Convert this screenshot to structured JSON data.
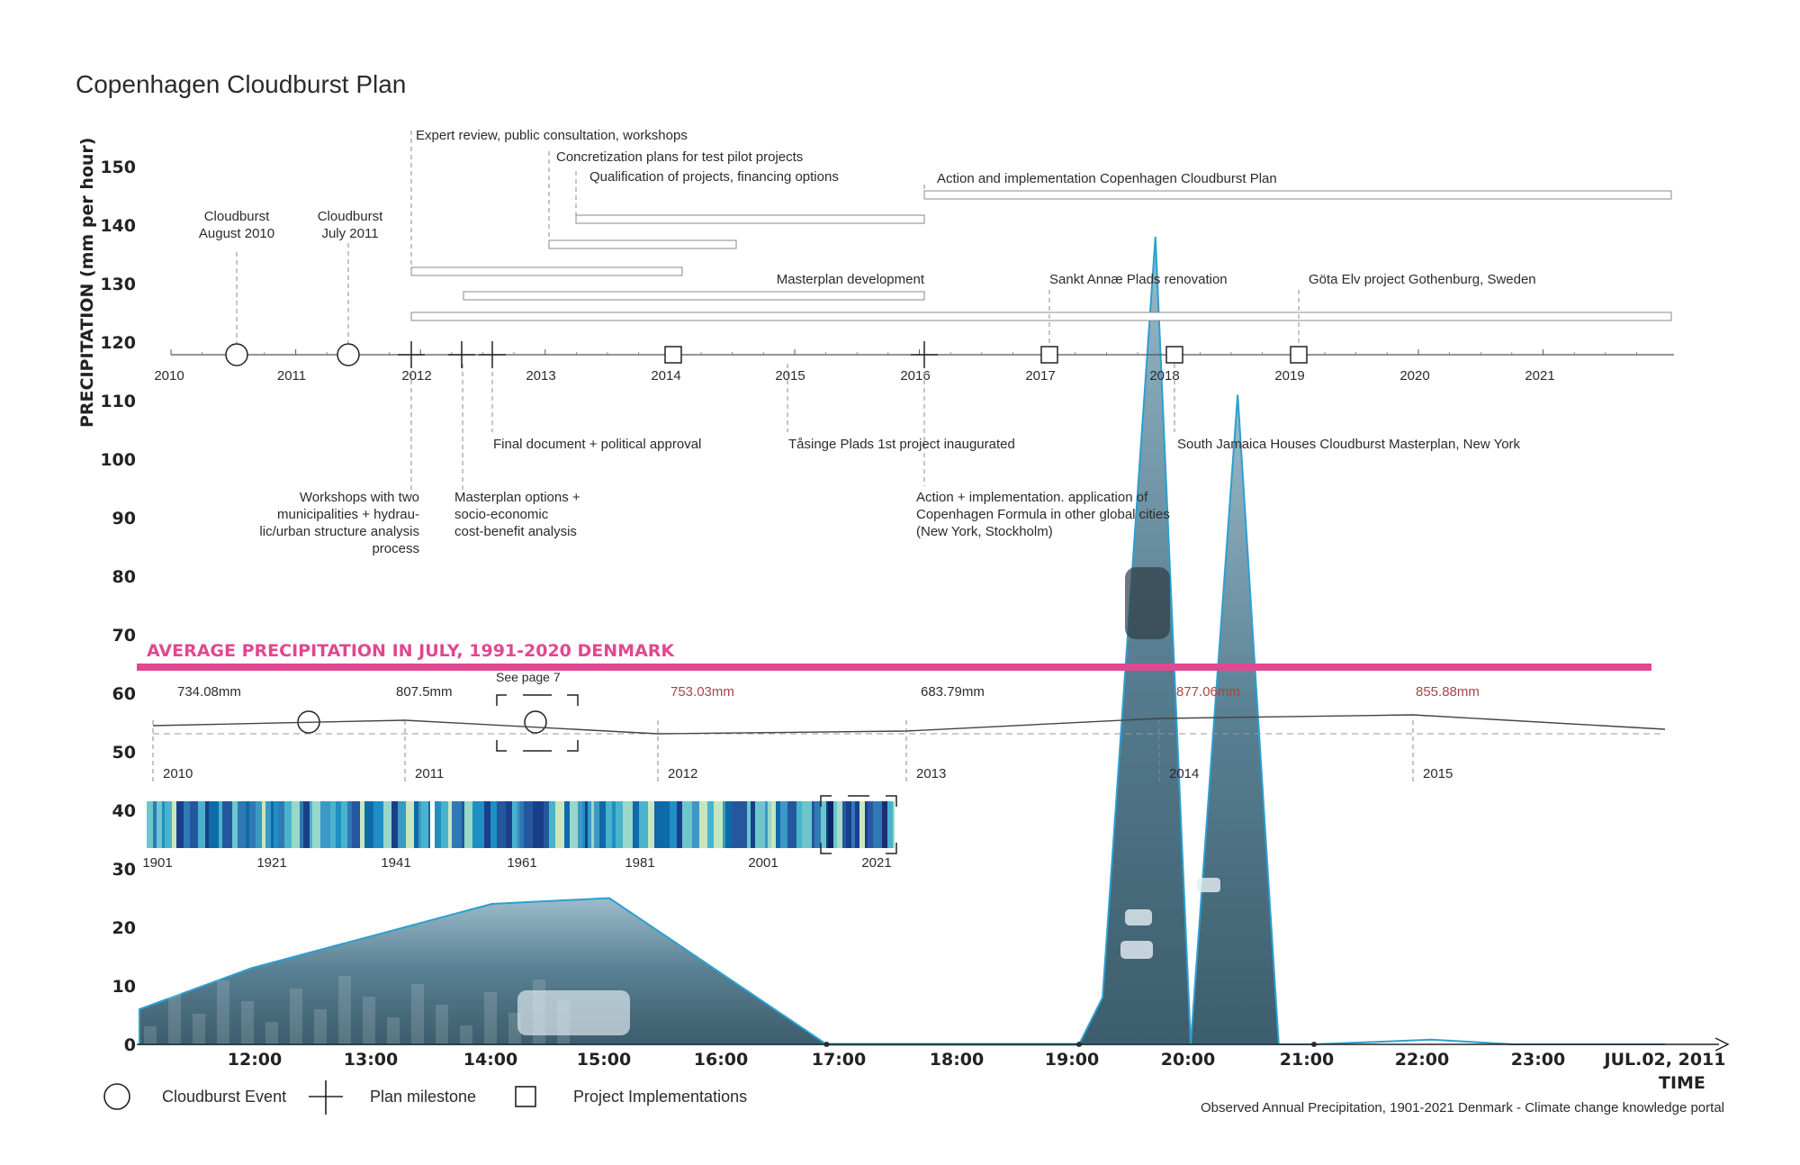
{
  "title": "Copenhagen Cloudburst Plan",
  "colors": {
    "accent": "#e0488f",
    "photo": "#6a95a6",
    "bars_dark": "#1a3f8a",
    "bars_light": "#8fd6cf",
    "red_value": "#a94444"
  },
  "chart_data": {
    "type": "area",
    "ylabel": "PRECIPITATION (mm per hour)",
    "xlabel": "TIME",
    "y_ticks": [
      0,
      10,
      20,
      30,
      40,
      50,
      60,
      70,
      80,
      90,
      100,
      110,
      120,
      130,
      140,
      150
    ],
    "x_ticks": [
      "12:00",
      "13:00",
      "14:00",
      "15:00",
      "16:00",
      "17:00",
      "18:00",
      "19:00",
      "20:00",
      "21:00",
      "22:00",
      "23:00",
      "JUL.02, 2011"
    ],
    "hourly_precip": {
      "x": [
        11.0,
        11.95,
        14.0,
        15.0,
        16.85,
        17.0,
        19.0,
        19.2,
        19.65,
        19.95,
        20.35,
        20.7,
        20.9,
        21.0,
        22.0,
        22.7,
        23.5
      ],
      "y": [
        6,
        13,
        24,
        25,
        0,
        0,
        0,
        8,
        138,
        0,
        111,
        0,
        0,
        0,
        0.8,
        0,
        0
      ]
    },
    "average_line": {
      "label": "AVERAGE PRECIPITATION IN JULY, 1991-2020 DENMARK",
      "value": 65.5
    },
    "timeline": {
      "years": [
        "2010",
        "2011",
        "2012",
        "2013",
        "2014",
        "2015",
        "2016",
        "2017",
        "2018",
        "2019",
        "2020",
        "2021"
      ],
      "events_above": [
        {
          "label": "Cloudburst\nAugust 2010"
        },
        {
          "label": "Cloudburst\nJuly 2011"
        },
        {
          "label": "Expert review, public consultation, workshops"
        },
        {
          "label": "Concretization plans for test pilot projects"
        },
        {
          "label": "Qualification of projects, financing options"
        },
        {
          "label": "Action and implementation Copenhagen Cloudburst Plan"
        },
        {
          "label": "Masterplan development"
        },
        {
          "label": "Sankt Annæ Plads renovation"
        },
        {
          "label": "Göta Elv project Gothenburg, Sweden"
        }
      ],
      "events_below": [
        {
          "label": "Final document + political approval"
        },
        {
          "label": "Tåsinge Plads 1st project inaugurated"
        },
        {
          "label": "South Jamaica Houses Cloudburst Masterplan, New York"
        },
        {
          "label": "Workshops with two\nmunicipalities + hydrau-\nlic/urban structure analysis\nprocess"
        },
        {
          "label": "Masterplan options +\nsocio-economic\ncost-benefit analysis"
        },
        {
          "label": "Action + implementation. application of\nCopenhagen Formula in other global cities\n(New York, Stockholm)"
        }
      ]
    },
    "annual_precip": {
      "years": [
        "2010",
        "2011",
        "2012",
        "2013",
        "2014",
        "2015"
      ],
      "values_mm": [
        "734.08mm",
        "807.5mm",
        "753.03mm",
        "683.79mm",
        "877.06mm",
        "855.88mm"
      ],
      "note": "See page 7"
    },
    "stripes": {
      "labels": [
        "1901",
        "1921",
        "1941",
        "1961",
        "1981",
        "2001",
        "2021"
      ]
    }
  },
  "legend": [
    {
      "label": "Cloudburst Event",
      "icon": "circle-icon"
    },
    {
      "label": "Plan milestone",
      "icon": "cross-icon"
    },
    {
      "label": "Project Implementations",
      "icon": "square-icon"
    }
  ],
  "source": "Observed Annual Precipitation, 1901-2021 Denmark - Climate change knowledge portal"
}
